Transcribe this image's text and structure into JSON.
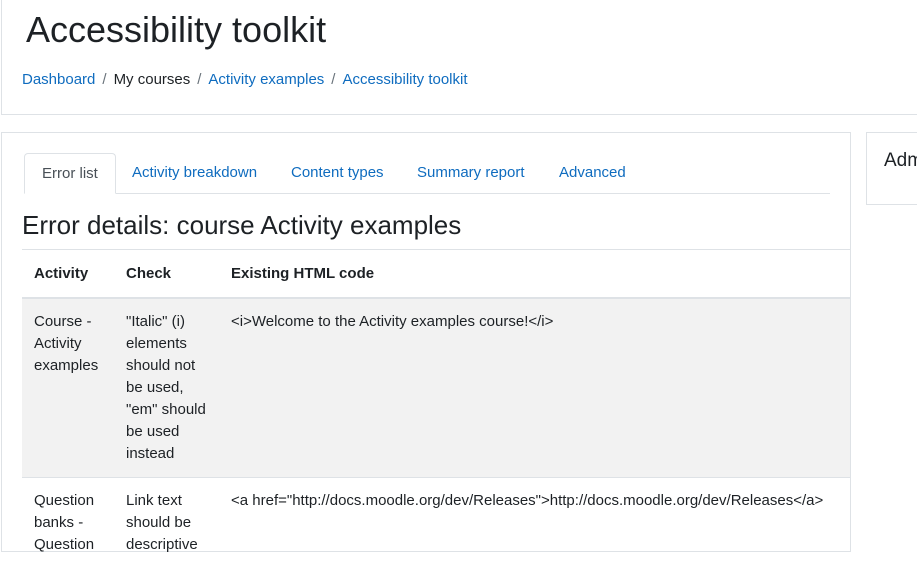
{
  "page": {
    "title": "Accessibility toolkit"
  },
  "breadcrumb": {
    "items": [
      {
        "label": "Dashboard",
        "link": true
      },
      {
        "label": "My courses",
        "link": false
      },
      {
        "label": "Activity examples",
        "link": true
      },
      {
        "label": "Accessibility toolkit",
        "link": true
      }
    ],
    "separator": "/"
  },
  "side_block": {
    "title": "Administration"
  },
  "tabs": [
    {
      "label": "Error list",
      "active": true
    },
    {
      "label": "Activity breakdown",
      "active": false
    },
    {
      "label": "Content types",
      "active": false
    },
    {
      "label": "Summary report",
      "active": false
    },
    {
      "label": "Advanced",
      "active": false
    }
  ],
  "section": {
    "title": "Error details: course Activity examples"
  },
  "table": {
    "headers": [
      "Activity",
      "Check",
      "Existing HTML code"
    ],
    "rows": [
      {
        "activity": "Course - Activity examples",
        "check": "\"Italic\" (i) elements should not be used, \"em\" should be used instead",
        "html": "<i>Welcome to the Activity examples course!</i>"
      },
      {
        "activity": "Question banks - Question",
        "check": "Link text should be descriptive",
        "html": "<a href=\"http://docs.moodle.org/dev/Releases\">http://docs.moodle.org/dev/Releases</a>"
      }
    ]
  },
  "colors": {
    "link": "#0f6cbf",
    "text": "#1d2125",
    "border": "#dee2e6",
    "stripe": "#f2f2f2"
  }
}
